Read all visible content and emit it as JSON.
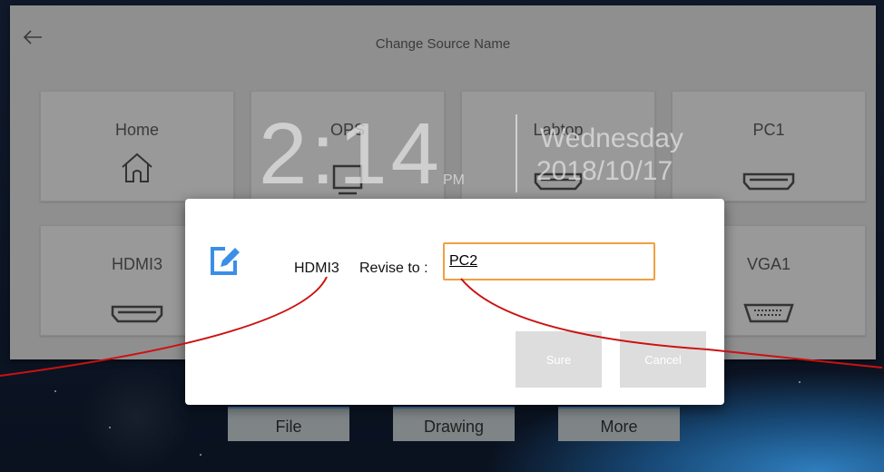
{
  "header": {
    "title": "Change Source Name"
  },
  "tiles": [
    {
      "label": "Home"
    },
    {
      "label": "OPS"
    },
    {
      "label": "Labtop"
    },
    {
      "label": "PC1"
    },
    {
      "label": "HDMI3"
    },
    {
      "label": "VGA1"
    }
  ],
  "clock": {
    "time": "2:14",
    "ampm": "PM",
    "day": "Wednesday",
    "date": "2018/10/17"
  },
  "toolbar": {
    "file": "File",
    "drawing": "Drawing",
    "more": "More"
  },
  "dialog": {
    "source_name": "HDMI3",
    "revise_label": "Revise to :",
    "input_value": "PC2",
    "sure_label": "Sure",
    "cancel_label": "Cancel"
  },
  "colors": {
    "annotation": "#cc1111",
    "input_border": "#f0a040",
    "edit_icon": "#3b8ee8"
  }
}
